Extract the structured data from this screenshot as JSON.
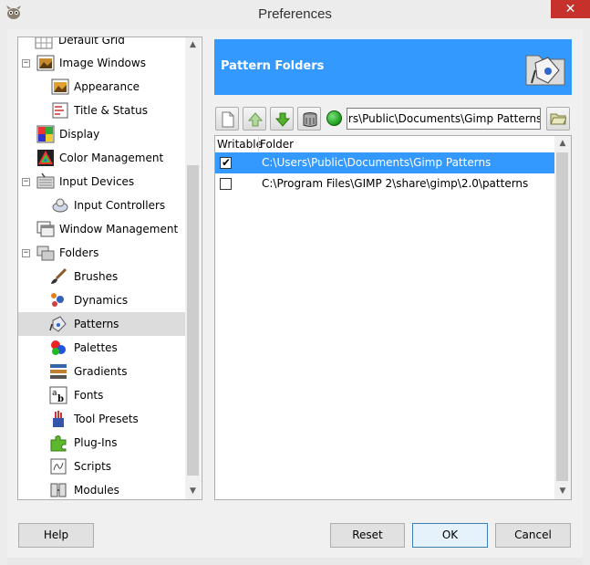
{
  "window": {
    "title": "Preferences",
    "close_label": "✕"
  },
  "sidebar": {
    "items": [
      {
        "label": "Default Grid",
        "icon": "grid-icon"
      },
      {
        "label": "Image Windows",
        "icon": "image-window-icon"
      },
      {
        "label": "Appearance",
        "icon": "appearance-icon"
      },
      {
        "label": "Title & Status",
        "icon": "title-status-icon"
      },
      {
        "label": "Display",
        "icon": "display-icon"
      },
      {
        "label": "Color Management",
        "icon": "color-management-icon"
      },
      {
        "label": "Input Devices",
        "icon": "input-devices-icon"
      },
      {
        "label": "Input Controllers",
        "icon": "input-controllers-icon"
      },
      {
        "label": "Window Management",
        "icon": "window-management-icon"
      },
      {
        "label": "Folders",
        "icon": "folders-icon"
      },
      {
        "label": "Brushes",
        "icon": "brush-icon"
      },
      {
        "label": "Dynamics",
        "icon": "dynamics-icon"
      },
      {
        "label": "Patterns",
        "icon": "patterns-icon"
      },
      {
        "label": "Palettes",
        "icon": "palette-icon"
      },
      {
        "label": "Gradients",
        "icon": "gradient-icon"
      },
      {
        "label": "Fonts",
        "icon": "font-icon"
      },
      {
        "label": "Tool Presets",
        "icon": "tool-presets-icon"
      },
      {
        "label": "Plug-Ins",
        "icon": "plugin-icon"
      },
      {
        "label": "Scripts",
        "icon": "script-icon"
      },
      {
        "label": "Modules",
        "icon": "module-icon"
      }
    ],
    "selected": "Patterns"
  },
  "banner": {
    "title": "Pattern Folders"
  },
  "toolbar": {
    "path_value": "C:\\Users\\Public\\Documents\\Gimp Patterns"
  },
  "list": {
    "col_writable": "Writable",
    "col_folder": "Folder",
    "rows": [
      {
        "checked": true,
        "path": "C:\\Users\\Public\\Documents\\Gimp Patterns"
      },
      {
        "checked": false,
        "path": "C:\\Program Files\\GIMP 2\\share\\gimp\\2.0\\patterns"
      }
    ]
  },
  "buttons": {
    "help": "Help",
    "reset": "Reset",
    "ok": "OK",
    "cancel": "Cancel"
  },
  "colors": {
    "accent": "#3399ff",
    "close": "#c7312c"
  }
}
